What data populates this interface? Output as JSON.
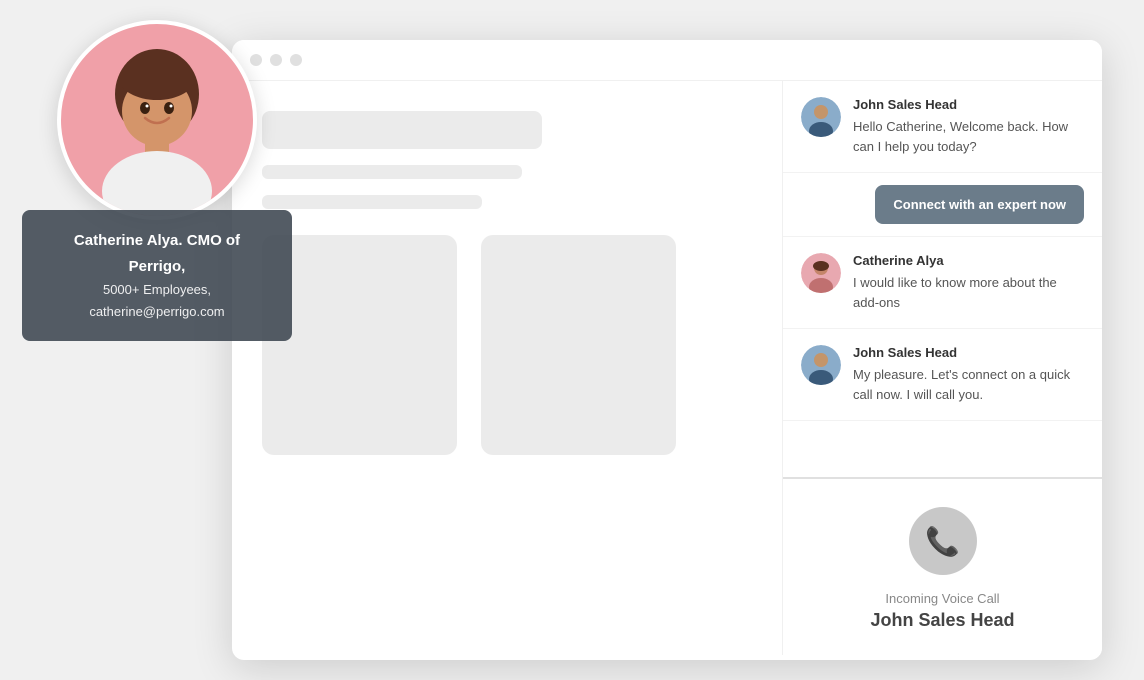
{
  "browser": {
    "dots": [
      "dot1",
      "dot2",
      "dot3"
    ]
  },
  "profile": {
    "name": "Catherine Alya. CMO of Perrigo,",
    "employees": "5000+ Employees,",
    "email": "catherine@perrigo.com"
  },
  "chat": {
    "message1": {
      "sender": "John Sales Head",
      "text": "Hello Catherine, Welcome back. How can I help you today?"
    },
    "connect_button": "Connect with an expert now",
    "message2": {
      "sender": "Catherine Alya",
      "text": "I would like to know more about the add-ons"
    },
    "message3": {
      "sender": "John Sales Head",
      "text": "My pleasure. Let's connect on a quick call now. I will call you."
    },
    "incoming": {
      "label": "Incoming Voice Call",
      "caller": "John Sales Head"
    }
  }
}
